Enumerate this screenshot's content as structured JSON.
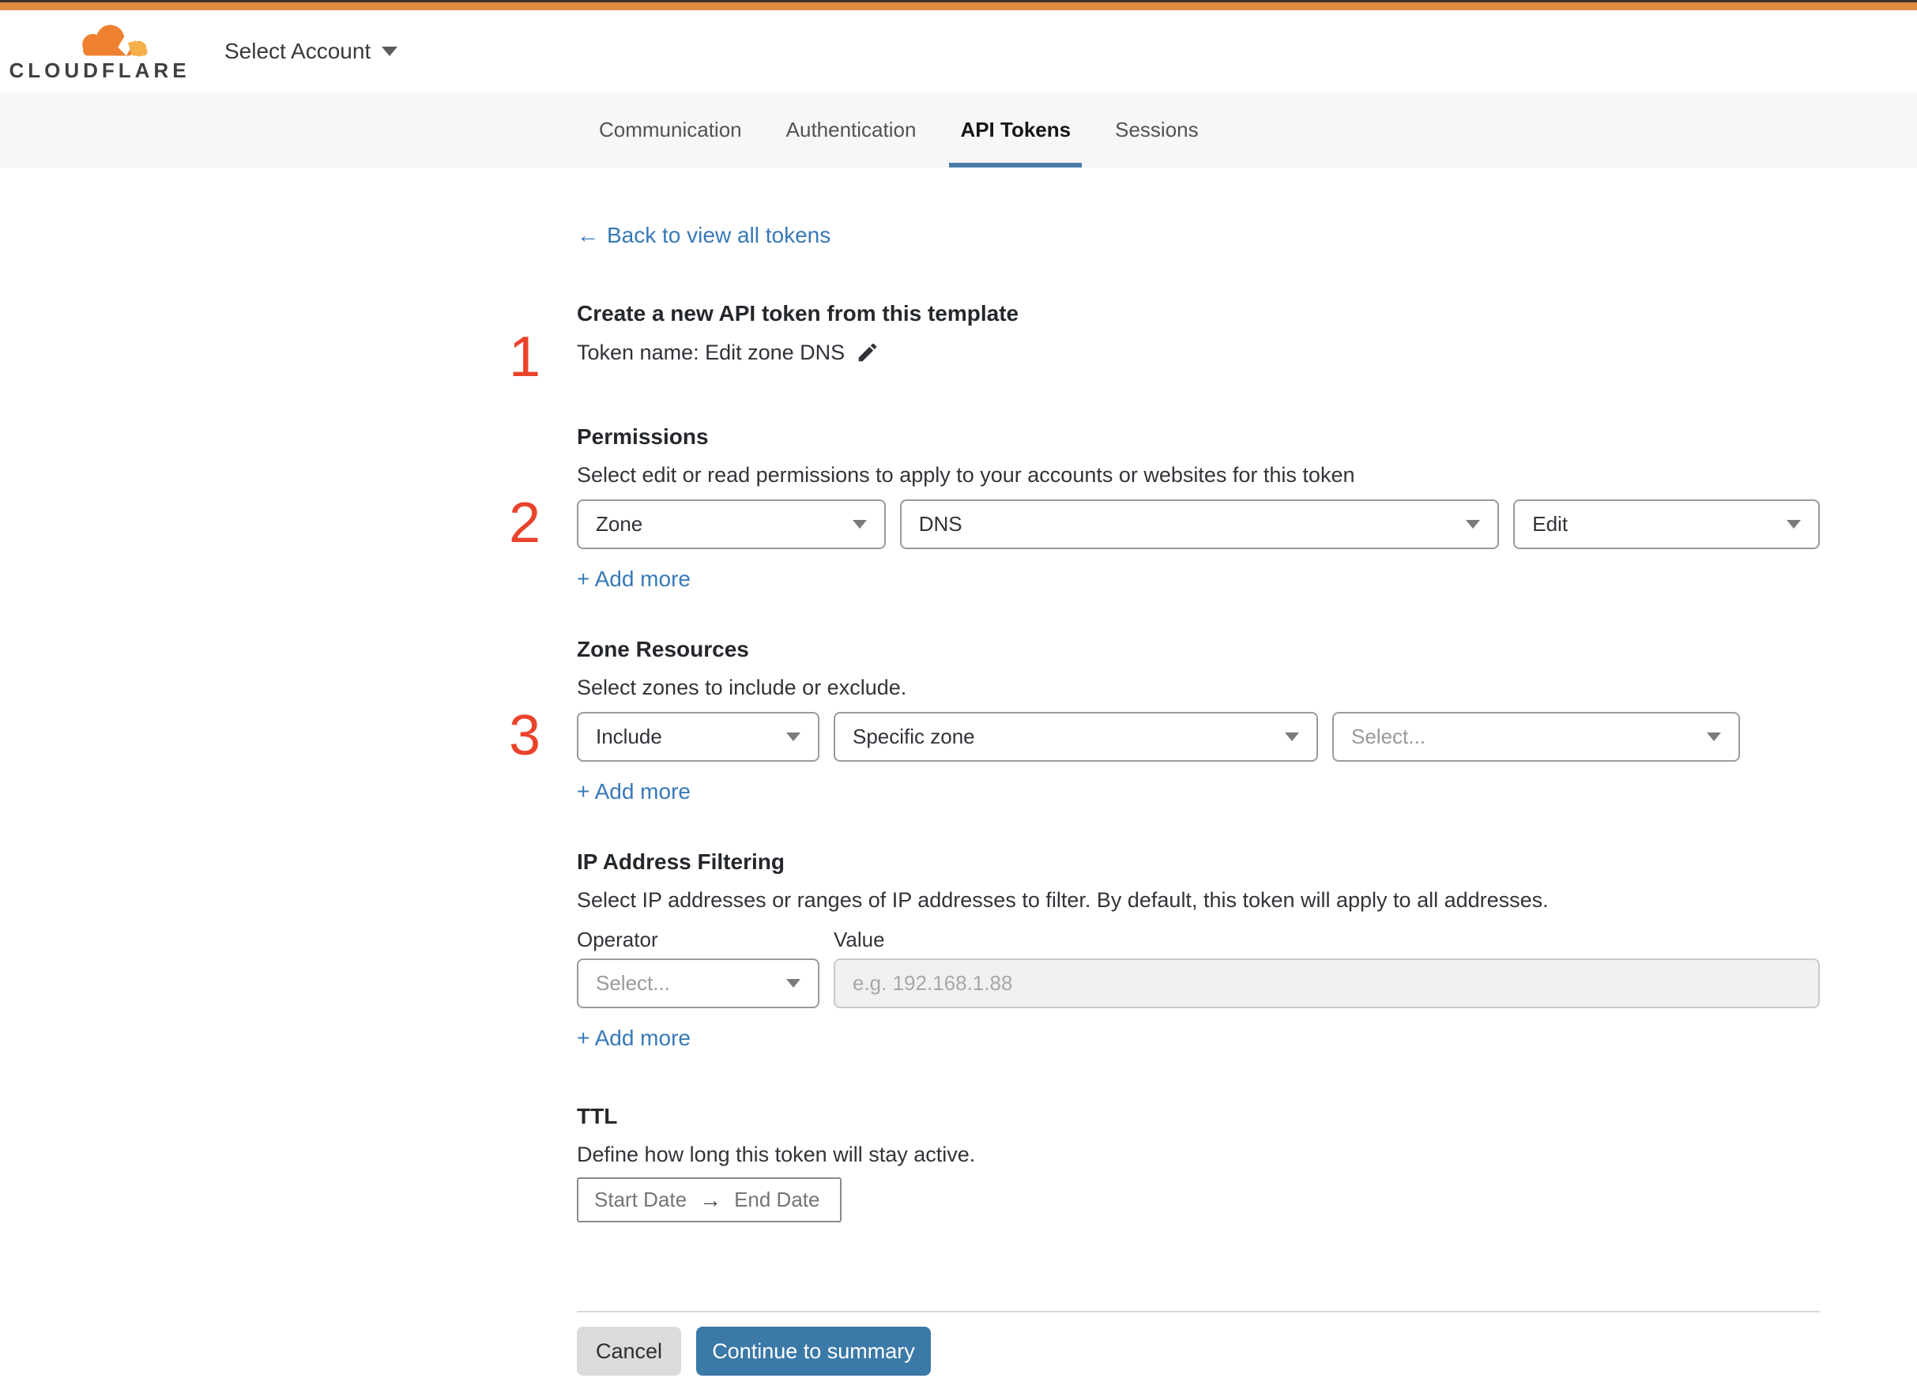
{
  "header": {
    "logo_text": "CLOUDFLARE",
    "account_selector": "Select Account"
  },
  "tabs": {
    "items": [
      {
        "label": "Communication",
        "active": false
      },
      {
        "label": "Authentication",
        "active": false
      },
      {
        "label": "API Tokens",
        "active": true
      },
      {
        "label": "Sessions",
        "active": false
      }
    ]
  },
  "page": {
    "back_arrow": "←",
    "back_link": "Back to view all tokens",
    "step1": {
      "number": "1",
      "heading": "Create a new API token from this template",
      "token_name_line": "Token name: Edit zone DNS"
    },
    "permissions": {
      "number": "2",
      "title": "Permissions",
      "description": "Select edit or read permissions to apply to your accounts or websites for this token",
      "scope_value": "Zone",
      "service_value": "DNS",
      "access_value": "Edit",
      "add_more": "+ Add more"
    },
    "zone_resources": {
      "number": "3",
      "title": "Zone Resources",
      "description": "Select zones to include or exclude.",
      "mode_value": "Include",
      "type_value": "Specific zone",
      "zone_value": "Select...",
      "add_more": "+ Add more"
    },
    "ip_filtering": {
      "title": "IP Address Filtering",
      "description": "Select IP addresses or ranges of IP addresses to filter. By default, this token will apply to all addresses.",
      "operator_label": "Operator",
      "value_label": "Value",
      "operator_value": "Select...",
      "value_placeholder": "e.g. 192.168.1.88",
      "add_more": "+ Add more"
    },
    "ttl": {
      "title": "TTL",
      "description": "Define how long this token will stay active.",
      "start_label": "Start Date",
      "arrow": "→",
      "end_label": "End Date"
    },
    "footer": {
      "cancel_label": "Cancel",
      "continue_label": "Continue to summary"
    }
  },
  "colors": {
    "top_bar_orange": "#e08c40",
    "logo_orange": "#ee8030",
    "logo_orange_light": "#f5b04a",
    "link_blue": "#3779b8",
    "tab_underline_blue": "#4a7ba6",
    "primary_button_blue": "#3b79a7",
    "step_number_red": "#ea432c",
    "cancel_gray": "#dbdbdb"
  }
}
